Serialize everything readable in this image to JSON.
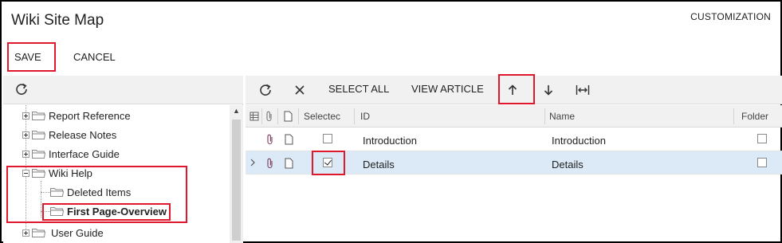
{
  "header": {
    "title": "Wiki Site Map",
    "customization_label": "CUSTOMIZATION"
  },
  "form_toolbar": {
    "save_label": "SAVE",
    "cancel_label": "CANCEL"
  },
  "tree": {
    "items": [
      {
        "label": "Report Reference"
      },
      {
        "label": "Release Notes"
      },
      {
        "label": "Interface Guide"
      },
      {
        "label": "Wiki Help"
      },
      {
        "label": "Deleted Items"
      },
      {
        "label": "First Page-Overview"
      },
      {
        "label": "User Guide"
      }
    ]
  },
  "grid_toolbar": {
    "select_all_label": "SELECT ALL",
    "view_article_label": "VIEW ARTICLE"
  },
  "grid": {
    "columns": {
      "selected": "Selectec",
      "id": "ID",
      "name": "Name",
      "folder": "Folder"
    },
    "rows": [
      {
        "id": "Introduction",
        "name": "Introduction",
        "selected": false,
        "folder": false
      },
      {
        "id": "Details",
        "name": "Details",
        "selected": true,
        "folder": false
      }
    ]
  },
  "colors": {
    "highlight": "#e0182e",
    "selected_row": "#dce9f6",
    "toolbar_bg": "#f1f1f1"
  }
}
